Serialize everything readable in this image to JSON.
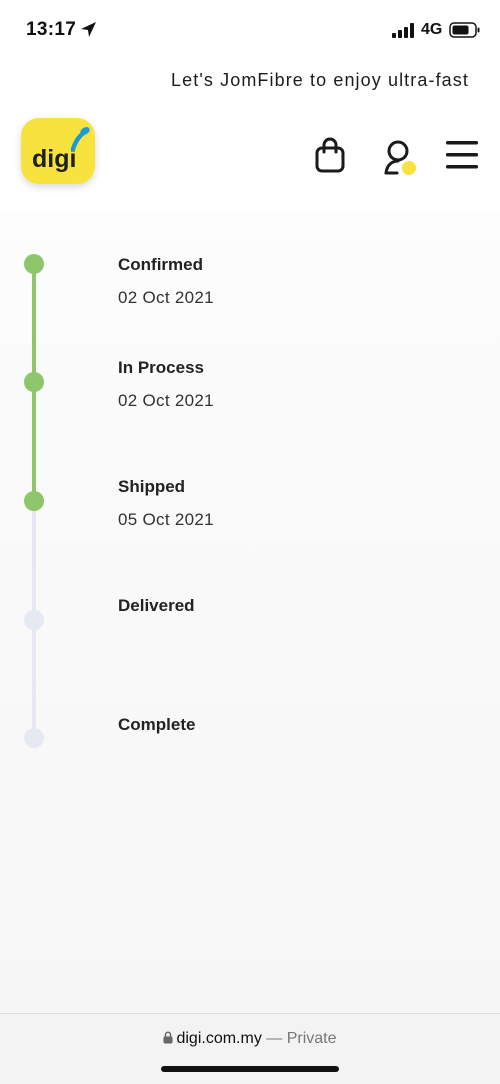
{
  "status_bar": {
    "time": "13:17",
    "network": "4G"
  },
  "promo": {
    "text": "Let's JomFibre to enjoy ultra-fast"
  },
  "header": {
    "logo_text": "digi"
  },
  "colors": {
    "complete": "#8ec66b",
    "pending": "#e6e9f1",
    "brand": "#f8e23d"
  },
  "timeline": [
    {
      "title": "Confirmed",
      "date": "02 Oct 2021",
      "done": true
    },
    {
      "title": "In Process",
      "date": "02 Oct 2021",
      "done": true
    },
    {
      "title": "Shipped",
      "date": "05 Oct 2021",
      "done": true
    },
    {
      "title": "Delivered",
      "date": "",
      "done": false
    },
    {
      "title": "Complete",
      "date": "",
      "done": false
    }
  ],
  "url_bar": {
    "domain": "digi.com.my",
    "privacy": "— Private"
  }
}
